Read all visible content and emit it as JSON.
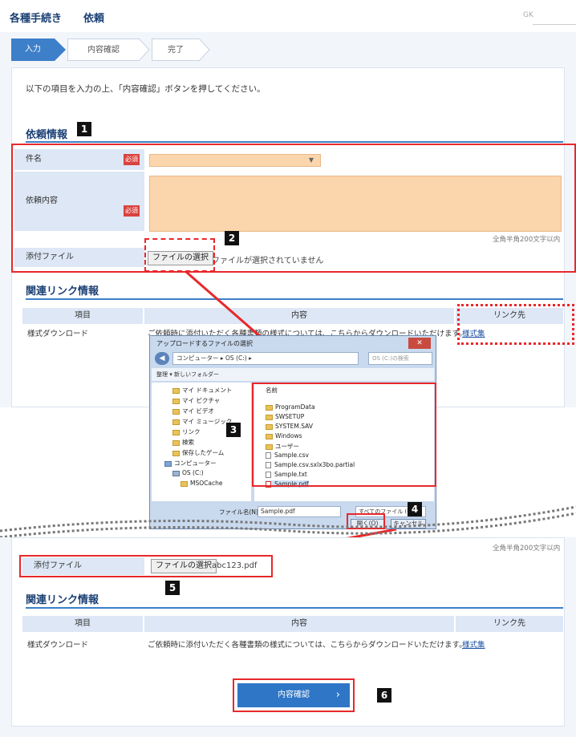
{
  "header": {
    "title": "各種手続き",
    "subtitle": "依頼",
    "right": "GK"
  },
  "steps": [
    "入力",
    "内容確認",
    "完了"
  ],
  "guide": "以下の項目を入力の上、「内容確認」ボタンを押してください。",
  "request_section": {
    "title": "依頼情報",
    "subject_label": "件名",
    "content_label": "依頼内容",
    "attach_label": "添付ファイル",
    "required": "必須",
    "select_value": "",
    "char_limit": "全角半角200文字以内",
    "file_button": "ファイルの選択",
    "no_file": "ファイルが選択されていません",
    "selected_file": "abc123.pdf"
  },
  "links_section": {
    "title": "関連リンク情報",
    "headers": [
      "項目",
      "内容",
      "リンク先"
    ],
    "rows": [
      {
        "item": "様式ダウンロード",
        "content": "ご依頼時に添付いただく各種書類の様式については、こちらからダウンロードいただけます。",
        "link": "様式集"
      }
    ]
  },
  "dialog": {
    "title": "アップロードするファイルの選択",
    "address": "コンピューター ▸ OS (C:) ▸",
    "search": "OS (C:)の検索",
    "toolbar": "整理 ▾    新しいフォルダー",
    "tree": [
      "マイ ドキュメント",
      "マイ ピクチャ",
      "マイ ビデオ",
      "マイ ミュージック",
      "リンク",
      "検索",
      "保存したゲーム",
      "コンピューター",
      "OS (C:)",
      "MSOCache"
    ],
    "list_header": "名前",
    "files": [
      "ProgramData",
      "SWSETUP",
      "SYSTEM.SAV",
      "Windows",
      "ユーザー",
      "Sample.csv",
      "Sample.csv.sxlx3bo.partial",
      "Sample.txt",
      "Sample.pdf"
    ],
    "filename_label": "ファイル名(N):",
    "filename": "Sample.pdf",
    "filetype": "すべてのファイル (*.*)",
    "open": "開く(O)",
    "cancel": "キャンセル"
  },
  "confirm_button": "内容確認",
  "badges": [
    "1",
    "2",
    "3",
    "4",
    "5",
    "6"
  ]
}
